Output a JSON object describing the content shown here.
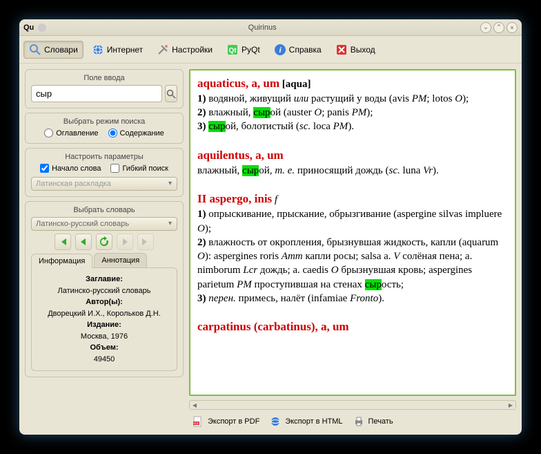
{
  "window": {
    "title": "Quirinus",
    "logo": "Qu"
  },
  "toolbar": {
    "dictionaries": "Словари",
    "internet": "Интернет",
    "settings": "Настройки",
    "pyqt": "PyQt",
    "help": "Справка",
    "exit": "Выход"
  },
  "search": {
    "label": "Поле ввода",
    "value": "сыр"
  },
  "mode": {
    "label": "Выбрать режим поиска",
    "toc": "Оглавление",
    "content": "Содержание"
  },
  "params": {
    "label": "Настроить параметры",
    "wordstart": "Начало слова",
    "fuzzy": "Гибкий поиск",
    "layout": "Латинская раскладка"
  },
  "dict": {
    "label": "Выбрать словарь",
    "selected": "Латинско-русский словарь"
  },
  "tabs": {
    "info": "Информация",
    "annot": "Аннотация"
  },
  "info": {
    "title_label": "Заглавие:",
    "title": "Латинско-русский словарь",
    "authors_label": "Автор(ы):",
    "authors": "Дворецкий И.Х., Корольков Д.Н.",
    "edition_label": "Издание:",
    "edition": "Москва, 1976",
    "volume_label": "Объем:",
    "volume": "49450"
  },
  "export": {
    "pdf": "Экспорт в PDF",
    "html": "Экспорт в HTML",
    "print": "Печать"
  },
  "results_html": "<span class=\"hw\">aquaticus, a, um</span> <span class=\"etym\">[aqua]</span><br><b>1)</b> водяной, живущий <span class=\"gram\">или</span> растущий у воды (avis <span class=\"abbr\">PM</span>; lotos <span class=\"abbr\">O</span>);<br><b>2)</b> влажный, <span class=\"hl\">сыр</span>ой (auster <span class=\"abbr\">O</span>; panis <span class=\"abbr\">PM</span>);<br><b>3)</b> <span class=\"hl\">сыр</span>ой, болотистый (<span class=\"abbr\">sc.</span> loca <span class=\"abbr\">PM</span>).<br><br><span class=\"hw\">aquilentus, a, um</span><br>влажный, <span class=\"hl\">сыр</span>ой, <span class=\"gram\">m. e.</span> приносящий дождь (<span class=\"abbr\">sc.</span> luna <span class=\"abbr\">Vr</span>).<br><br><span class=\"hw\">II aspergo, inis</span> <span class=\"gram\">f</span><br><b>1)</b> опрыскивание, прыскание, обрызгивание (aspergine silvas impluere <span class=\"abbr\">O</span>);<br><b>2)</b> влажность от окропления, брызнувшая жидкость, капли (aquarum <span class=\"abbr\">O</span>): aspergines roris <span class=\"abbr\">Amm</span> капли росы; salsa a. <span class=\"abbr\">V</span> солёная пена; a. nimborum <span class=\"abbr\">Lcr</span> дождь; a. caedis <span class=\"abbr\">O</span> брызнувшая кровь; aspergines parietum <span class=\"abbr\">PM</span> проступившая на стенах <span class=\"hl\">сыр</span>ость;<br><b>3)</b> <span class=\"gram\">перен.</span> примесь, налёт (infamiae <span class=\"abbr\">Fronto</span>).<br><br><span class=\"hw\">carpatinus (carbatinus), a, um</span>"
}
